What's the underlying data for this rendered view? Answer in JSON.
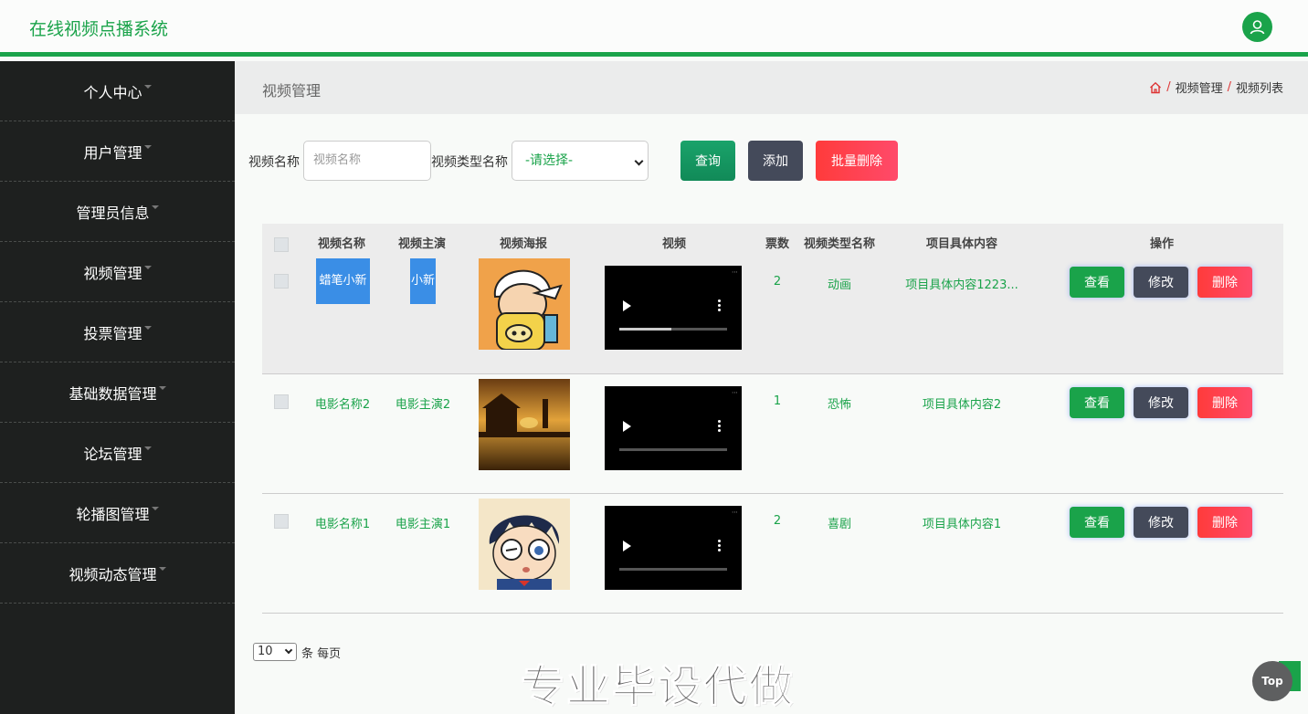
{
  "header": {
    "title": "在线视频点播系统",
    "user_icon": "user-icon"
  },
  "sidebar": {
    "items": [
      {
        "label": "个人中心"
      },
      {
        "label": "用户管理"
      },
      {
        "label": "管理员信息"
      },
      {
        "label": "视频管理"
      },
      {
        "label": "投票管理"
      },
      {
        "label": "基础数据管理"
      },
      {
        "label": "论坛管理"
      },
      {
        "label": "轮播图管理"
      },
      {
        "label": "视频动态管理"
      }
    ]
  },
  "page": {
    "title": "视频管理",
    "breadcrumb": [
      "视频管理",
      "视频列表"
    ]
  },
  "search": {
    "name_label": "视频名称",
    "name_placeholder": "视频名称",
    "type_label": "视频类型名称",
    "type_selected": "-请选择-",
    "query_button": "查询",
    "add_button": "添加",
    "batch_delete_button": "批量删除"
  },
  "table": {
    "columns": [
      "视频名称",
      "视频主演",
      "视频海报",
      "视频",
      "票数",
      "视频类型名称",
      "项目具体内容",
      "操作"
    ],
    "rows": [
      {
        "name": "蜡笔小新",
        "actor": "小新",
        "votes": "2",
        "type": "动画",
        "content": "项目具体内容1223...",
        "progress": 0.48
      },
      {
        "name": "电影名称2",
        "actor": "电影主演2",
        "votes": "1",
        "type": "恐怖",
        "content": "项目具体内容2",
        "progress": 0.0
      },
      {
        "name": "电影名称1",
        "actor": "电影主演1",
        "votes": "2",
        "type": "喜剧",
        "content": "项目具体内容1",
        "progress": 0.0
      }
    ],
    "actions": {
      "view": "查看",
      "edit": "修改",
      "delete": "删除"
    }
  },
  "pagination": {
    "page_size": "10",
    "suffix": "条 每页"
  },
  "watermark": "专业毕设代做",
  "top_button": "Top",
  "colors": {
    "brand": "#1aa34a",
    "sidebar": "#1e201f",
    "danger": "#ff3b3b",
    "dark_button": "#444a5a"
  }
}
